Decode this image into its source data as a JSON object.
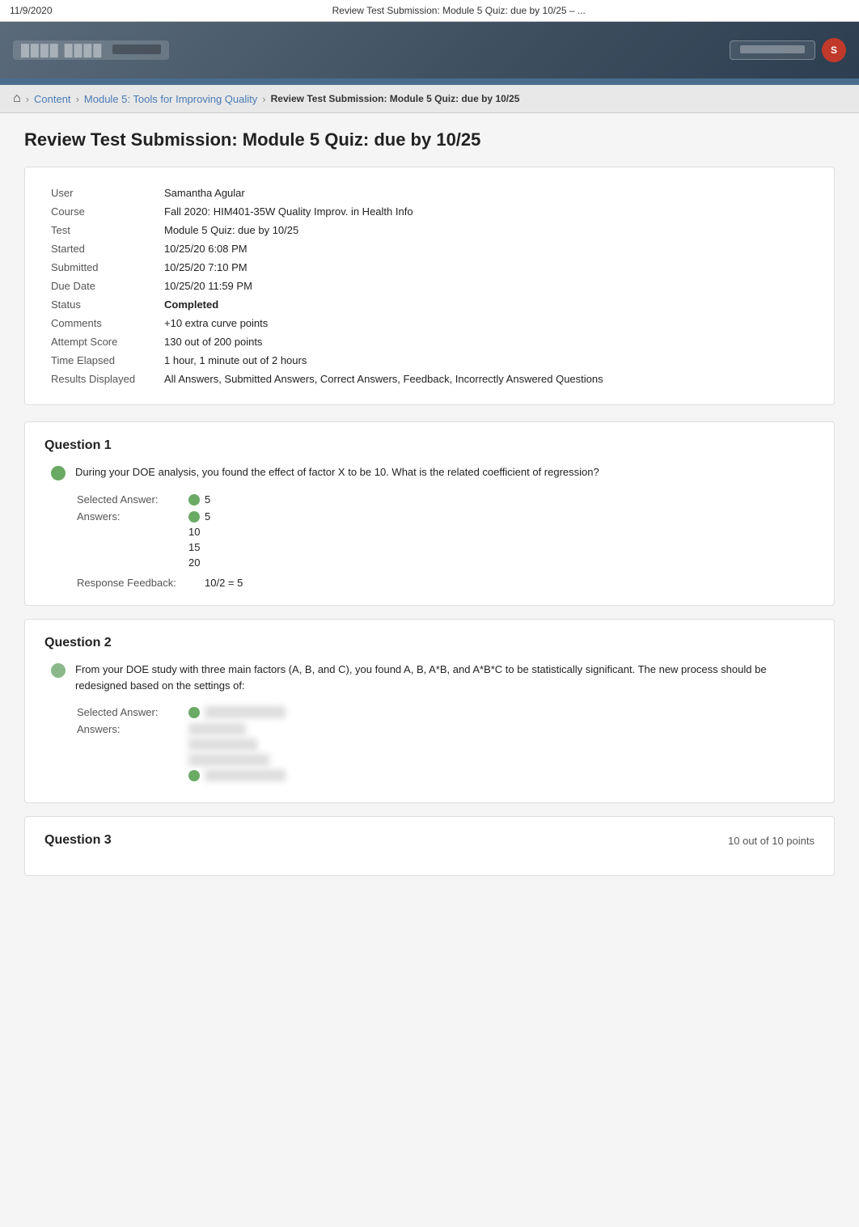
{
  "browser": {
    "date": "11/9/2020",
    "title": "Review Test Submission: Module 5 Quiz: due by 10/25 – ..."
  },
  "header": {
    "logo_text": "BLLBB",
    "logo_sub": "LEARN",
    "user_button": "Samantha Agular",
    "avatar_initials": "S"
  },
  "breadcrumb": {
    "home_icon": "⌂",
    "links": [
      "Content",
      "Module 5: Tools for Improving Quality"
    ],
    "current": "Review Test Submission: Module 5 Quiz: due by 10/25"
  },
  "page": {
    "title": "Review Test Submission: Module 5 Quiz: due by 10/25"
  },
  "submission_info": {
    "user_label": "User",
    "user_value": "Samantha Agular",
    "course_label": "Course",
    "course_value": "Fall 2020: HIM401-35W Quality Improv. in Health Info",
    "test_label": "Test",
    "test_value": "Module 5 Quiz: due by 10/25",
    "started_label": "Started",
    "started_value": "10/25/20 6:08 PM",
    "submitted_label": "Submitted",
    "submitted_value": "10/25/20 7:10 PM",
    "due_date_label": "Due Date",
    "due_date_value": "10/25/20 11:59 PM",
    "status_label": "Status",
    "status_value": "Completed",
    "comments_label": "Comments",
    "comments_value": "+10 extra curve points",
    "attempt_score_label": "Attempt Score",
    "attempt_score_value": "130 out of 200 points",
    "time_elapsed_label": "Time Elapsed",
    "time_elapsed_value": "1 hour, 1 minute out of 2 hours",
    "results_displayed_label": "Results Displayed",
    "results_displayed_value": "All Answers, Submitted Answers, Correct Answers, Feedback, Incorrectly Answered Questions"
  },
  "questions": [
    {
      "id": "q1",
      "title": "Question 1",
      "points": null,
      "text": "During your DOE analysis, you found the effect of factor X to be 10. What is the related coefficient of regression?",
      "selected_answer": "5",
      "answers": [
        "5",
        "10",
        "15",
        "20"
      ],
      "correct_answer_index": 0,
      "response_feedback_label": "Response Feedback:",
      "response_feedback": "10/2 = 5"
    },
    {
      "id": "q2",
      "title": "Question 2",
      "points": null,
      "text": "From your DOE study with three main factors (A, B, and C), you found  A, B, A*B, and A*B*C to be statistically significant. The new process should be redesigned based on the settings of:",
      "selected_answer_label": "Selected Answer:",
      "selected_answer_blurred": "Apply A*B*C only",
      "answers_label": "Answers:",
      "answers_blurred": [
        "Apply A only",
        "Apply A*B only",
        "Apply A*B*C only",
        "Apply A*B*C only"
      ],
      "correct_answer_index": 3
    },
    {
      "id": "q3",
      "title": "Question 3",
      "points": "10 out of 10 points",
      "text": ""
    }
  ]
}
